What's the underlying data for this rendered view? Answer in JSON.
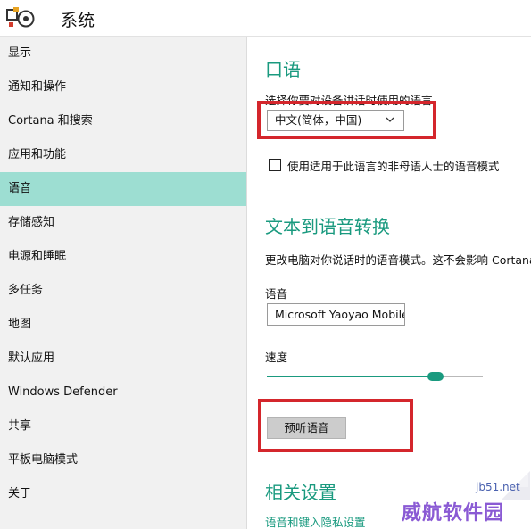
{
  "window": {
    "title": "系统",
    "app_icon": "settings-logo-icon"
  },
  "sidebar": {
    "items": [
      {
        "label": "显示"
      },
      {
        "label": "通知和操作"
      },
      {
        "label": "Cortana 和搜索"
      },
      {
        "label": "应用和功能"
      },
      {
        "label": "语音",
        "active": true
      },
      {
        "label": "存储感知"
      },
      {
        "label": "电源和睡眠"
      },
      {
        "label": "多任务"
      },
      {
        "label": "地图"
      },
      {
        "label": "默认应用"
      },
      {
        "label": "Windows Defender"
      },
      {
        "label": "共享"
      },
      {
        "label": "平板电脑模式"
      },
      {
        "label": "关于"
      }
    ]
  },
  "speech": {
    "heading": "口语",
    "prompt": "选择你要对设备讲话时使用的语言",
    "language_selected": "中文(简体，中国)",
    "nonnative_label": "使用适用于此语言的非母语人士的语音模式",
    "nonnative_checked": false
  },
  "tts": {
    "heading": "文本到语音转换",
    "description": "更改电脑对你说话时的语音模式。这不会影响 Cortana",
    "voice_label": "语音",
    "voice_value": "Microsoft Yaoyao Mobile",
    "speed_label": "速度",
    "speed_fraction": 0.78,
    "preview_label": "预听语音"
  },
  "related": {
    "heading": "相关设置",
    "link": "语音和键入隐私设置"
  },
  "watermark": {
    "url": "jb51.net",
    "text": "威航软件园"
  },
  "colors": {
    "accent": "#1a9a7f",
    "active_nav": "#9dded2",
    "highlight": "#d4262c"
  }
}
